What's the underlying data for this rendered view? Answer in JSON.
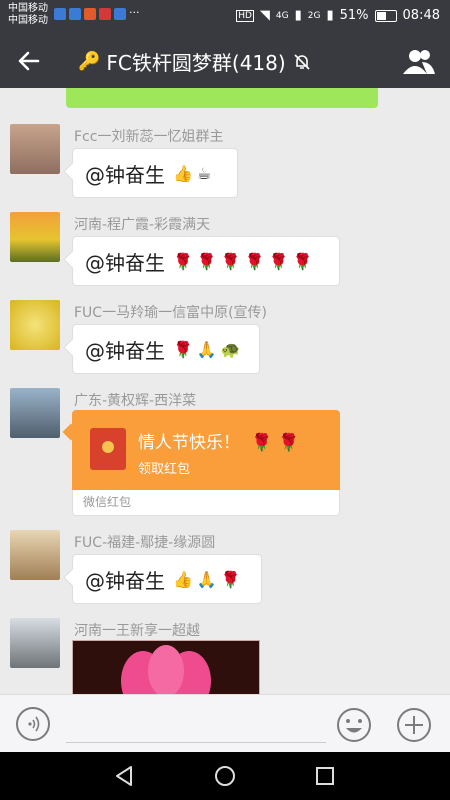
{
  "status": {
    "carrier1": "中国移动",
    "carrier2": "中国移动",
    "more": "···",
    "hd": "HD",
    "net1": "4G",
    "net2": "2G",
    "battery": "51%",
    "time": "08:48"
  },
  "header": {
    "title": "FC铁杆圆梦群(418)"
  },
  "messages": [
    {
      "name": "Fcc一刘新蕊一忆姐群主",
      "text": "@钟奋生",
      "emoji": "👍☕"
    },
    {
      "name": "河南-程广霞-彩霞满天",
      "text": "@钟奋生",
      "emoji": "🌹🌹🌹🌹🌹🌹"
    },
    {
      "name": "FUC一马羚瑜一信富中原(宣传)",
      "text": "@钟奋生",
      "emoji": "🌹🙏🐢"
    },
    {
      "name": "广东-黄权辉-西洋菜",
      "redpacket_title": "情人节快乐！",
      "redpacket_emoji": "🌹 🌹",
      "redpacket_action": "领取红包",
      "redpacket_footer": "微信红包"
    },
    {
      "name": "FUC-福建-鄢捷-缘源圆",
      "text": "@钟奋生",
      "emoji": "👍🙏🌹"
    },
    {
      "name": "河南一王新享一超越"
    }
  ],
  "colors": {
    "header_bg": "#393a3f",
    "chat_bg": "#ebebeb",
    "redpacket": "#fa9d3b",
    "sent_bubble": "#9ee65a"
  }
}
